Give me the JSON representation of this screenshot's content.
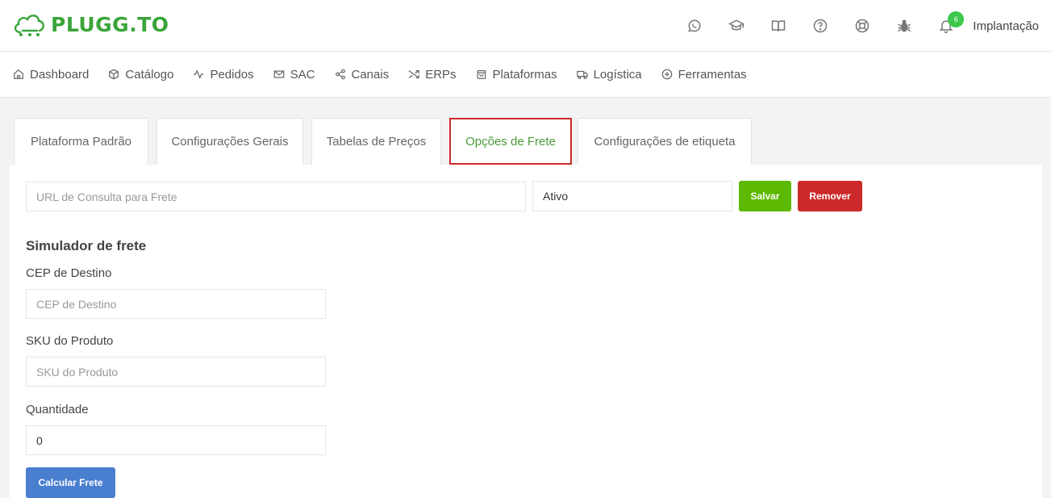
{
  "brand": {
    "name": "PLUGG.TO",
    "color": "#3aa53a"
  },
  "header": {
    "icons": [
      "whatsapp-icon",
      "graduation-cap-icon",
      "book-icon",
      "help-icon",
      "lifebuoy-icon",
      "bug-icon",
      "bell-icon"
    ],
    "notification_count": "6",
    "user": "Implantação"
  },
  "nav": {
    "items": [
      {
        "label": "Dashboard",
        "icon": "home-icon"
      },
      {
        "label": "Catálogo",
        "icon": "box-icon"
      },
      {
        "label": "Pedidos",
        "icon": "activity-icon"
      },
      {
        "label": "SAC",
        "icon": "mail-icon"
      },
      {
        "label": "Canais",
        "icon": "share-icon"
      },
      {
        "label": "ERPs",
        "icon": "shuffle-icon"
      },
      {
        "label": "Plataformas",
        "icon": "bag-icon"
      },
      {
        "label": "Logística",
        "icon": "truck-icon"
      },
      {
        "label": "Ferramentas",
        "icon": "plus-circle-icon"
      }
    ]
  },
  "tabs": {
    "items": [
      {
        "label": "Plataforma Padrão"
      },
      {
        "label": "Configurações Gerais"
      },
      {
        "label": "Tabelas de Preços"
      },
      {
        "label": "Opções de Frete",
        "active": true
      },
      {
        "label": "Configurações de etiqueta"
      }
    ],
    "active_border_color": "#cc2a2a",
    "active_text_color": "#4a9a3a"
  },
  "frete": {
    "url_placeholder": "URL de Consulta para Frete",
    "status_value": "Ativo",
    "save_label": "Salvar",
    "remove_label": "Remover",
    "save_color": "#5cb800",
    "remove_color": "#cc2a2a"
  },
  "simulator": {
    "title": "Simulador de frete",
    "cep_label": "CEP de Destino",
    "cep_placeholder": "CEP de Destino",
    "sku_label": "SKU do Produto",
    "sku_placeholder": "SKU do Produto",
    "qty_label": "Quantidade",
    "qty_value": "0",
    "calc_label": "Calcular Frete",
    "calc_color": "#4a7fd0"
  }
}
